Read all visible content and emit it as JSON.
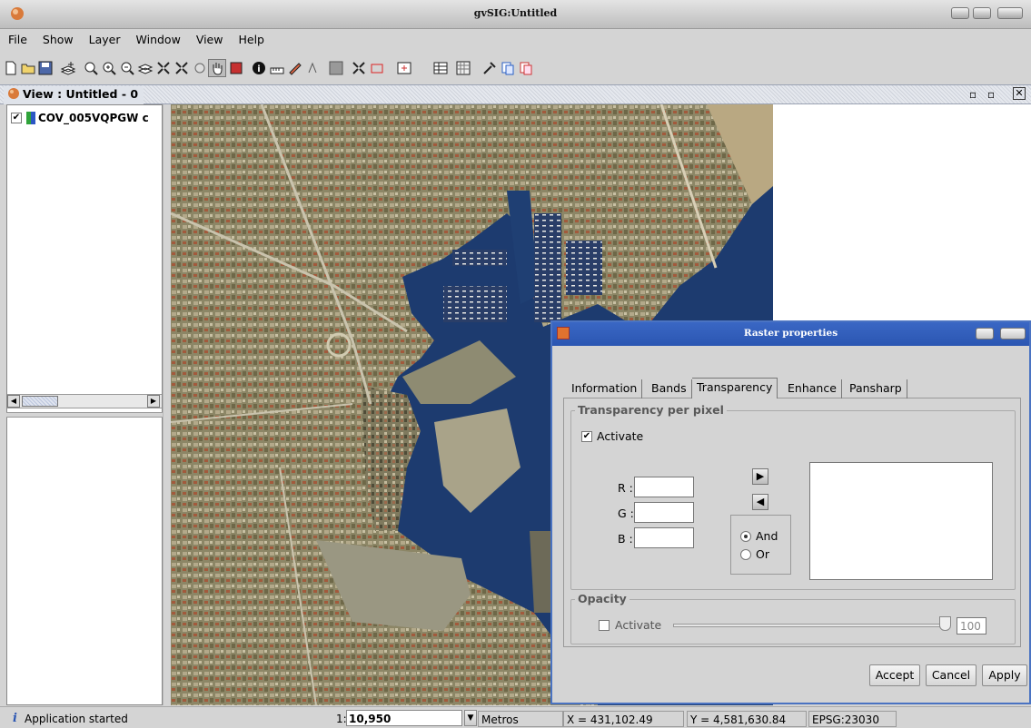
{
  "window": {
    "title": "gvSIG:Untitled",
    "icon": "gvsig-logo-icon"
  },
  "menubar": {
    "items": [
      "File",
      "Show",
      "Layer",
      "Window",
      "View",
      "Help"
    ]
  },
  "toolbar": {
    "icons": [
      "new-document-icon",
      "open-folder-icon",
      "save-icon",
      "add-layer-icon",
      "zoom-full-icon",
      "zoom-in-icon",
      "zoom-out-icon",
      "zoom-layer-icon",
      "zoom-select-icon",
      "zoom-expand-icon",
      "zoom-back-icon",
      "pan-hand-icon",
      "layer-props-icon",
      "info-icon",
      "measure-icon",
      "select-icon",
      "edit-icon",
      "fill-icon",
      "expand-icon",
      "rectangle-select-icon",
      "add-point-icon",
      "table-icon",
      "grid-icon",
      "tools-icon",
      "clip-icon",
      "clip2-icon"
    ]
  },
  "view": {
    "title": "View : Untitled - 0"
  },
  "toc": {
    "layer_name": "COV_005VQPGW c"
  },
  "dialog": {
    "title": "Raster properties",
    "tabs": [
      "Information",
      "Bands",
      "Transparency",
      "Enhance",
      "Pansharp"
    ],
    "active_tab": "Transparency",
    "pixel_group": {
      "title": "Transparency per pixel",
      "activate_label": "Activate",
      "activate_checked": true,
      "r_label": "R :",
      "g_label": "G :",
      "b_label": "B :",
      "r_value": "",
      "g_value": "",
      "b_value": "",
      "and_label": "And",
      "or_label": "Or",
      "selected_logic": "And"
    },
    "opacity_group": {
      "title": "Opacity",
      "activate_label": "Activate",
      "activate_checked": false,
      "value": "100"
    },
    "buttons": {
      "accept": "Accept",
      "cancel": "Cancel",
      "apply": "Apply"
    }
  },
  "status": {
    "message": "Application started",
    "scale_prefix": "1:",
    "scale": "10,950",
    "units": "Metros",
    "x": "X = 431,102.49",
    "y": "Y = 4,581,630.84",
    "crs": "EPSG:23030"
  },
  "colors": {
    "accent": "#2b56b2",
    "sea": "#1d3b6f",
    "land": "#8f8e6c"
  }
}
